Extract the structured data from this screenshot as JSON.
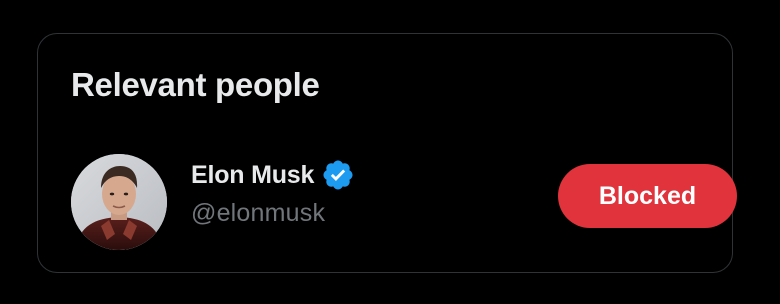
{
  "section": {
    "title": "Relevant people"
  },
  "person": {
    "display_name": "Elon Musk",
    "handle": "@elonmusk",
    "verified": true,
    "avatar_icon": "profile-photo",
    "verified_icon": "verified-badge-icon",
    "block_button_label": "Blocked"
  },
  "colors": {
    "background": "#000000",
    "border": "#2f3336",
    "primary_text": "#e7e9ea",
    "secondary_text": "#71767b",
    "verified_blue": "#1d9bf0",
    "blocked_red": "#e0333c"
  }
}
